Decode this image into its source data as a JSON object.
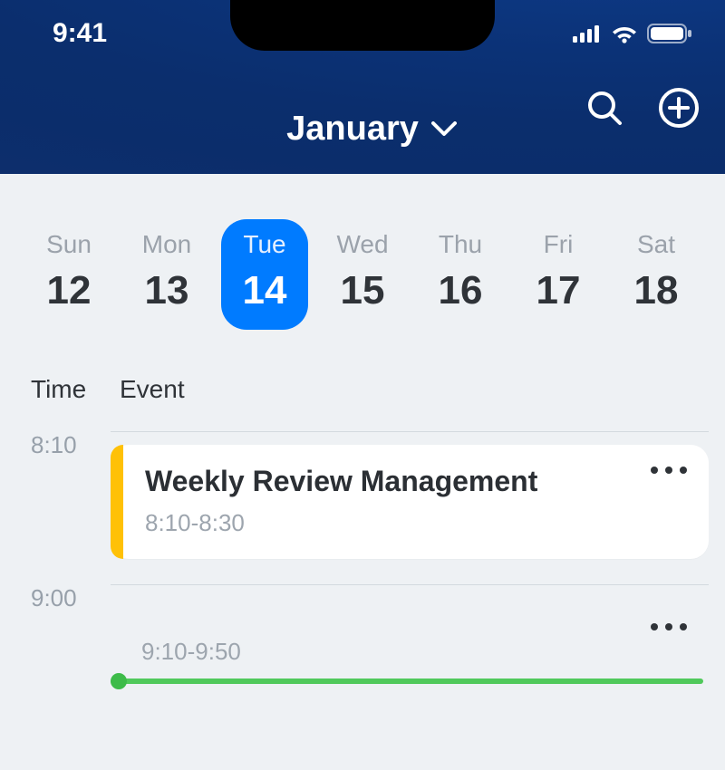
{
  "status": {
    "time": "9:41"
  },
  "header": {
    "month": "January"
  },
  "week": {
    "days": [
      {
        "label": "Sun",
        "num": "12",
        "selected": false
      },
      {
        "label": "Mon",
        "num": "13",
        "selected": false
      },
      {
        "label": "Tue",
        "num": "14",
        "selected": true
      },
      {
        "label": "Wed",
        "num": "15",
        "selected": false
      },
      {
        "label": "Thu",
        "num": "16",
        "selected": false
      },
      {
        "label": "Fri",
        "num": "17",
        "selected": false
      },
      {
        "label": "Sat",
        "num": "18",
        "selected": false
      }
    ]
  },
  "schedule": {
    "columns": {
      "time": "Time",
      "event": "Event"
    },
    "slots": [
      {
        "time": "8:10",
        "event": {
          "title": "Weekly Review Management",
          "time_range": "8:10-8:30",
          "accent_color": "#ffc107"
        }
      },
      {
        "time": "9:00",
        "event": {
          "title": "",
          "time_range": "9:10-9:50",
          "progress_color": "#50c95b"
        }
      }
    ]
  }
}
